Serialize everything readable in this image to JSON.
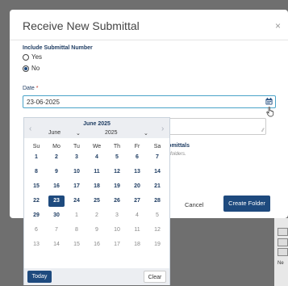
{
  "dialog": {
    "title": "Receive New Submittal",
    "close_glyph": "×",
    "include_label": "Include Submittal Number",
    "yes_label": "Yes",
    "no_label": "No",
    "selected_option": "No",
    "date_label": "Date",
    "required_mark": "*",
    "date_value": "23-06-2025",
    "subfolders_heading": "submittals",
    "subfolders_note": "ittal folders.",
    "cancel_label": "Cancel",
    "create_label": "Create Folder"
  },
  "datepicker": {
    "title": "June 2025",
    "month_select": "June",
    "year_select": "2025",
    "weekdays": [
      "Su",
      "Mo",
      "Tu",
      "We",
      "Th",
      "Fr",
      "Sa"
    ],
    "selected_day": "23",
    "weeks": [
      [
        {
          "d": "1",
          "m": "cur"
        },
        {
          "d": "2",
          "m": "cur"
        },
        {
          "d": "3",
          "m": "cur"
        },
        {
          "d": "4",
          "m": "cur"
        },
        {
          "d": "5",
          "m": "cur"
        },
        {
          "d": "6",
          "m": "cur"
        },
        {
          "d": "7",
          "m": "cur"
        }
      ],
      [
        {
          "d": "8",
          "m": "cur"
        },
        {
          "d": "9",
          "m": "cur"
        },
        {
          "d": "10",
          "m": "cur"
        },
        {
          "d": "11",
          "m": "cur"
        },
        {
          "d": "12",
          "m": "cur"
        },
        {
          "d": "13",
          "m": "cur"
        },
        {
          "d": "14",
          "m": "cur"
        }
      ],
      [
        {
          "d": "15",
          "m": "cur"
        },
        {
          "d": "16",
          "m": "cur"
        },
        {
          "d": "17",
          "m": "cur"
        },
        {
          "d": "18",
          "m": "cur"
        },
        {
          "d": "19",
          "m": "cur"
        },
        {
          "d": "20",
          "m": "cur"
        },
        {
          "d": "21",
          "m": "cur"
        }
      ],
      [
        {
          "d": "22",
          "m": "cur"
        },
        {
          "d": "23",
          "m": "cur"
        },
        {
          "d": "24",
          "m": "cur"
        },
        {
          "d": "25",
          "m": "cur"
        },
        {
          "d": "26",
          "m": "cur"
        },
        {
          "d": "27",
          "m": "cur"
        },
        {
          "d": "28",
          "m": "cur"
        }
      ],
      [
        {
          "d": "29",
          "m": "cur"
        },
        {
          "d": "30",
          "m": "cur"
        },
        {
          "d": "1",
          "m": "other"
        },
        {
          "d": "2",
          "m": "other"
        },
        {
          "d": "3",
          "m": "other"
        },
        {
          "d": "4",
          "m": "other"
        },
        {
          "d": "5",
          "m": "other"
        }
      ],
      [
        {
          "d": "6",
          "m": "other"
        },
        {
          "d": "7",
          "m": "other"
        },
        {
          "d": "8",
          "m": "other"
        },
        {
          "d": "9",
          "m": "other"
        },
        {
          "d": "10",
          "m": "other"
        },
        {
          "d": "11",
          "m": "other"
        },
        {
          "d": "12",
          "m": "other"
        }
      ],
      [
        {
          "d": "13",
          "m": "other"
        },
        {
          "d": "14",
          "m": "other"
        },
        {
          "d": "15",
          "m": "other"
        },
        {
          "d": "16",
          "m": "other"
        },
        {
          "d": "17",
          "m": "other"
        },
        {
          "d": "18",
          "m": "other"
        },
        {
          "d": "19",
          "m": "other"
        }
      ]
    ],
    "today_label": "Today",
    "clear_label": "Clear",
    "prev_glyph": "‹",
    "next_glyph": "›"
  },
  "background": {
    "side_text": "Ne"
  },
  "colors": {
    "primary": "#1e4a7e",
    "focus_border": "#4aa3c8",
    "overlay": "#6f6f6f"
  },
  "icons": [
    "calendar-icon",
    "mouse-cursor-icon",
    "resize-handle-icon",
    "close-icon"
  ]
}
